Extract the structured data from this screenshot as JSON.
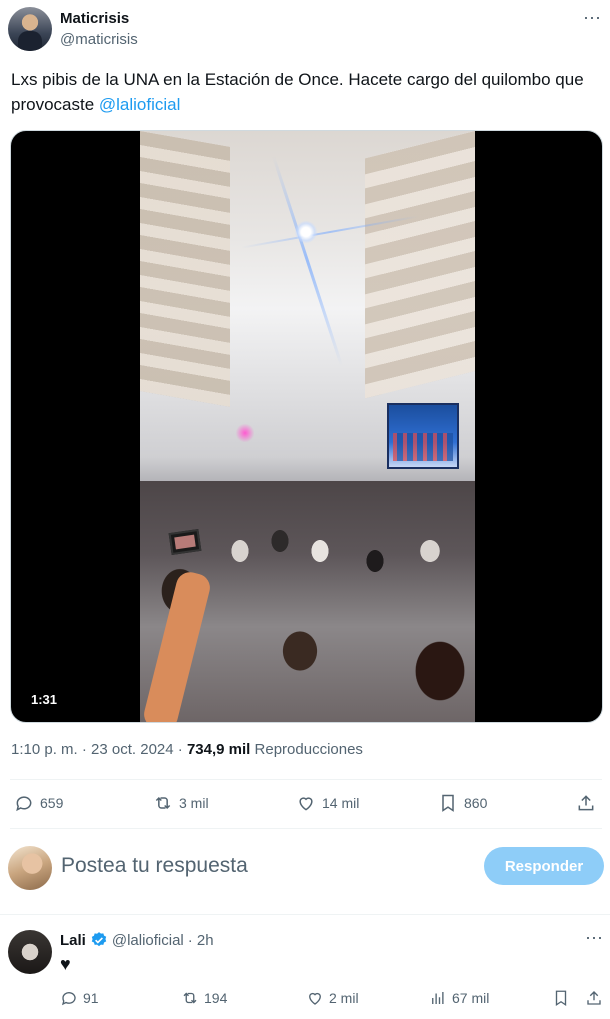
{
  "tweet": {
    "author_name": "Maticrisis",
    "author_handle": "@maticrisis",
    "text_main": "Lxs pibis de la UNA en la Estación de Once. Hacete cargo del quilombo que provocaste ",
    "mention": "@lalioficial",
    "video_duration": "1:31",
    "time": "1:10 p. m.",
    "date": "23 oct. 2024",
    "separator": "·",
    "views_count": "734,9 mil",
    "views_label": "Reproducciones",
    "more_icon": "⋯"
  },
  "actions": {
    "replies": "659",
    "reposts": "3 mil",
    "likes": "14 mil",
    "bookmarks": "860"
  },
  "reply_box": {
    "placeholder": "Postea tu respuesta",
    "button_label": "Responder"
  },
  "reply": {
    "author_name": "Lali",
    "author_handle": "@lalioficial",
    "time": "· 2h",
    "content": "♥",
    "more_icon": "⋯",
    "replies": "91",
    "reposts": "194",
    "likes": "2 mil",
    "views": "67 mil"
  },
  "colors": {
    "accent": "#1d9bf0",
    "button_disabled": "#8ecdf8",
    "muted_text": "#536471",
    "primary_text": "#0f1419"
  }
}
